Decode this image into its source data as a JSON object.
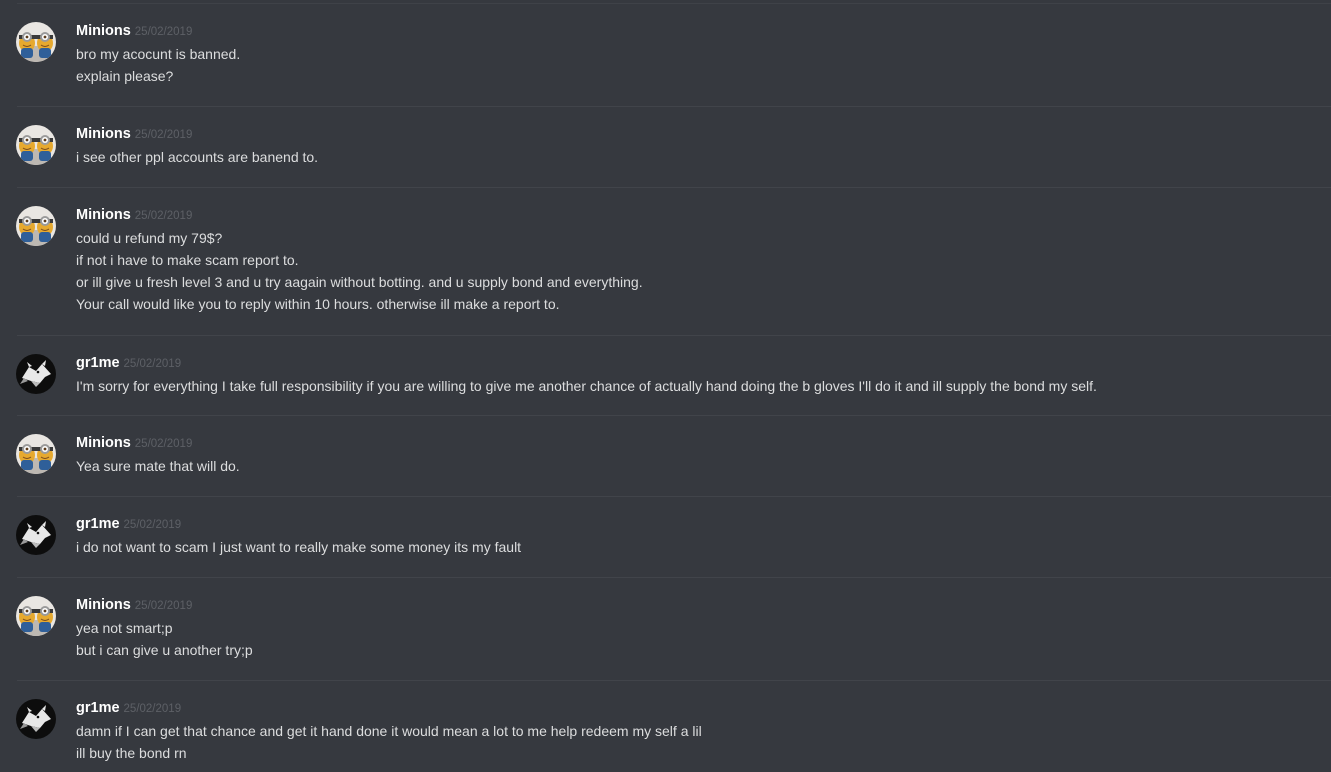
{
  "messages": [
    {
      "author": "Minions",
      "avatar_icon": "minion-avatar-icon",
      "timestamp": "25/02/2019",
      "lines": [
        "bro my acocunt is banned.",
        "explain please?"
      ]
    },
    {
      "author": "Minions",
      "avatar_icon": "minion-avatar-icon",
      "timestamp": "25/02/2019",
      "lines": [
        "i see other ppl accounts are banend to."
      ]
    },
    {
      "author": "Minions",
      "avatar_icon": "minion-avatar-icon",
      "timestamp": "25/02/2019",
      "lines": [
        "could u refund my 79$?",
        "if not i have to make scam report to.",
        "or ill give u fresh level 3 and u try aagain without botting. and u supply bond and everything.",
        "Your call would like you to reply within 10 hours. otherwise ill make a report to."
      ]
    },
    {
      "author": "gr1me",
      "avatar_icon": "wolf-avatar-icon",
      "timestamp": "25/02/2019",
      "lines": [
        "I'm sorry for everything I take full responsibility if you are willing to give me another chance of actually hand doing the b gloves I'll do it and ill supply the bond my self."
      ]
    },
    {
      "author": "Minions",
      "avatar_icon": "minion-avatar-icon",
      "timestamp": "25/02/2019",
      "lines": [
        "Yea sure mate that will do."
      ]
    },
    {
      "author": "gr1me",
      "avatar_icon": "wolf-avatar-icon",
      "timestamp": "25/02/2019",
      "lines": [
        "i do not want to scam I just want to really make some money its my fault"
      ]
    },
    {
      "author": "Minions",
      "avatar_icon": "minion-avatar-icon",
      "timestamp": "25/02/2019",
      "lines": [
        "yea not smart;p",
        "but i can give u another try;p"
      ]
    },
    {
      "author": "gr1me",
      "avatar_icon": "wolf-avatar-icon",
      "timestamp": "25/02/2019",
      "lines": [
        "damn if I can get that chance and get it hand done it would mean a lot to me help redeem my self a lil",
        "ill buy the bond rn"
      ]
    }
  ]
}
